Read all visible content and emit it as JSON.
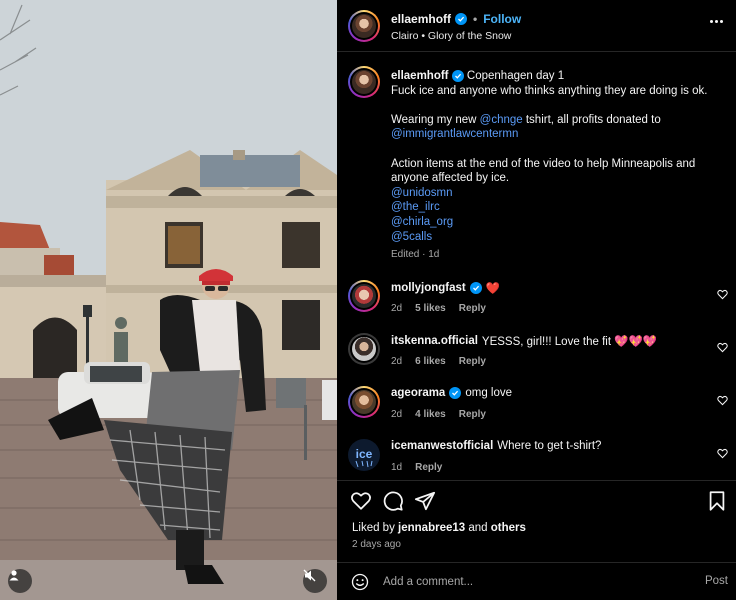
{
  "post": {
    "username": "ellaemhoff",
    "follow_label": "Follow",
    "dot": "•",
    "audio": "Clairo • Glory of the Snow",
    "caption": {
      "username": "ellaemhoff",
      "line1": "Copenhagen day 1",
      "line2": "Fuck ice and anyone who thinks anything they are doing is ok.",
      "line3_pre": "Wearing my new ",
      "line3_mention": "@chnge",
      "line3_post": " tshirt, all profits donated to",
      "line4_mention": "@immigrantlawcentermn",
      "line5": "Action items at the end of the video to help Minneapolis and anyone affected by ice.",
      "mentions": [
        "@unidosmn",
        "@the_ilrc",
        "@chirla_org",
        "@5calls"
      ],
      "meta": "Edited · 1d"
    }
  },
  "comments": [
    {
      "username": "mollyjongfast",
      "verified": true,
      "text": "❤️",
      "time": "2d",
      "likes": "5 likes",
      "reply": "Reply"
    },
    {
      "username": "itskenna.official",
      "verified": false,
      "text": "YESSS, girl!!! Love the fit 💖💖💖",
      "time": "2d",
      "likes": "6 likes",
      "reply": "Reply"
    },
    {
      "username": "ageorama",
      "verified": true,
      "text": "omg love",
      "time": "2d",
      "likes": "4 likes",
      "reply": "Reply"
    },
    {
      "username": "icemanwestofficial",
      "verified": false,
      "text": "Where to get t-shirt?",
      "time": "1d",
      "likes": "",
      "reply": "Reply"
    }
  ],
  "icons": {
    "like": "heart-icon",
    "comment": "comment-icon",
    "share": "share-icon",
    "save": "bookmark-icon",
    "more": "more-icon",
    "emoji": "emoji-icon",
    "tag": "user-tag-icon",
    "mute": "mute-icon"
  },
  "likes": {
    "prefix": "Liked by",
    "user": "jennabree13",
    "and": "and",
    "others": "others"
  },
  "time_ago": "2 days ago",
  "add_comment": {
    "placeholder": "Add a comment...",
    "post_label": "Post"
  },
  "colors": {
    "background": "#000000",
    "link": "#5b9bf6",
    "verified": "#0095f6",
    "follow": "#4db5f9",
    "muted_text": "#a8a8a8",
    "heart_red": "#ff3040"
  }
}
